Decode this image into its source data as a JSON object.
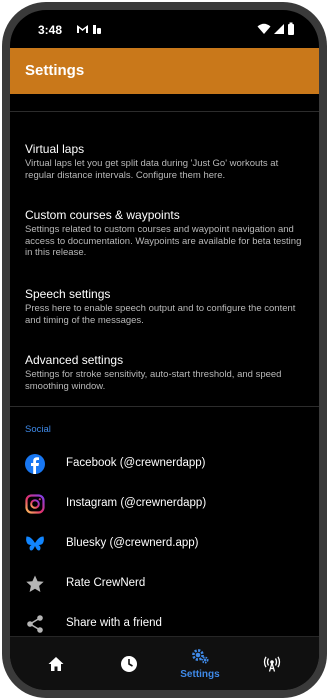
{
  "status_bar": {
    "time": "3:48"
  },
  "app_bar": {
    "title": "Settings"
  },
  "settings": [
    {
      "title": "Virtual laps",
      "description": "Virtual laps let you get split data during 'Just Go' workouts at regular distance intervals. Configure them here."
    },
    {
      "title": "Custom courses & waypoints",
      "description": "Settings related to custom courses and waypoint navigation and access to documentation. Waypoints are available for beta testing in this release."
    },
    {
      "title": "Speech settings",
      "description": "Press here to enable speech output and to configure the content and timing of the messages."
    },
    {
      "title": "Advanced settings",
      "description": "Settings for stroke sensitivity, auto-start threshold, and speed smoothing window."
    }
  ],
  "social": {
    "header": "Social",
    "items": [
      {
        "label": "Facebook (@crewnerdapp)",
        "icon": "facebook-icon"
      },
      {
        "label": "Instagram (@crewnerdapp)",
        "icon": "instagram-icon"
      },
      {
        "label": "Bluesky (@crewnerd.app)",
        "icon": "bluesky-icon"
      },
      {
        "label": "Rate CrewNerd",
        "icon": "star-icon"
      },
      {
        "label": "Share with a friend",
        "icon": "share-icon"
      }
    ]
  },
  "bottom_nav": {
    "items": [
      {
        "icon": "home-icon"
      },
      {
        "icon": "clock-icon"
      },
      {
        "icon": "gears-icon",
        "label": "Settings",
        "active": true
      },
      {
        "icon": "antenna-icon"
      }
    ]
  },
  "colors": {
    "accent": "#c9781a",
    "link": "#3f8ae8",
    "background": "#000000"
  }
}
